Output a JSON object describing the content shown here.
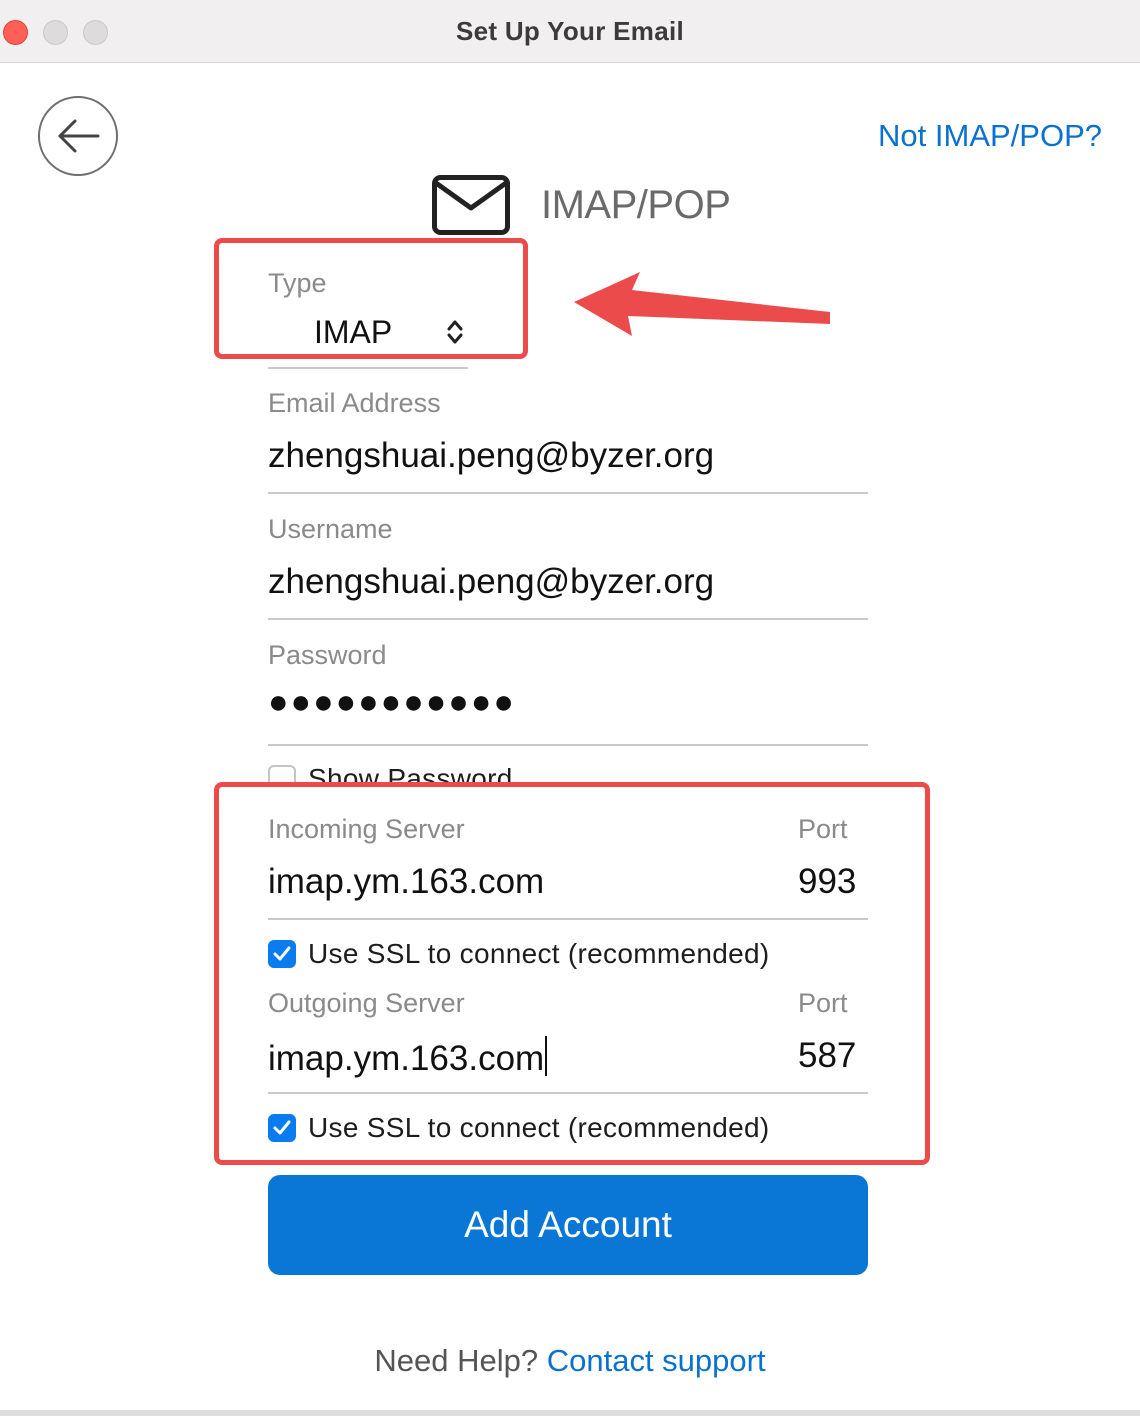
{
  "window": {
    "title": "Set Up Your Email"
  },
  "header": {
    "not_imap_link": "Not IMAP/POP?",
    "protocol_title": "IMAP/POP",
    "envelope_icon": "envelope-icon",
    "back_icon": "arrow-left-icon"
  },
  "form": {
    "type": {
      "label": "Type",
      "value": "IMAP"
    },
    "email": {
      "label": "Email Address",
      "value": "zhengshuai.peng@byzer.org"
    },
    "username": {
      "label": "Username",
      "value": "zhengshuai.peng@byzer.org"
    },
    "password": {
      "label": "Password",
      "masked": "●●●●●●●●●●●",
      "show_label": "Show Password",
      "show_checked": false
    },
    "incoming": {
      "label": "Incoming Server",
      "value": "imap.ym.163.com",
      "port_label": "Port",
      "port": "993",
      "ssl_label": "Use SSL to connect (recommended)",
      "ssl_checked": true
    },
    "outgoing": {
      "label": "Outgoing Server",
      "value": "imap.ym.163.com",
      "port_label": "Port",
      "port": "587",
      "ssl_label": "Use SSL to connect (recommended)",
      "ssl_checked": true
    }
  },
  "actions": {
    "add_account": "Add Account"
  },
  "footer": {
    "help_text": "Need Help?",
    "contact_link": "Contact support"
  },
  "colors": {
    "accent": "#0a77d6",
    "link": "#0a71d0",
    "annotation": "#ec4b4b",
    "checkbox": "#0b7cf0"
  }
}
